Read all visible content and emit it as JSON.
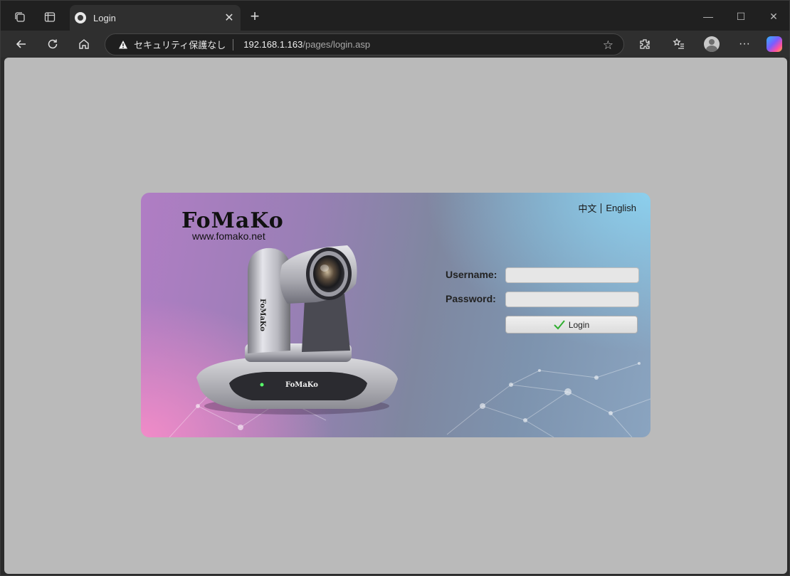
{
  "browser": {
    "tab_title": "Login",
    "security_label": "セキュリティ保護なし",
    "url_host": "192.168.1.163",
    "url_path": "/pages/login.asp"
  },
  "login_page": {
    "brand": "FoMaKo",
    "website": "www.fomako.net",
    "camera_brand": "FoMaKo",
    "lang_chinese": "中文",
    "lang_english": "English",
    "username_label": "Username:",
    "password_label": "Password:",
    "username_value": "",
    "password_value": "",
    "login_button": "Login"
  },
  "colors": {
    "page_bg": "#bababa",
    "chrome_dark": "#202020",
    "card_pink": "#f58cc8",
    "card_blue": "#8cd2f0"
  }
}
